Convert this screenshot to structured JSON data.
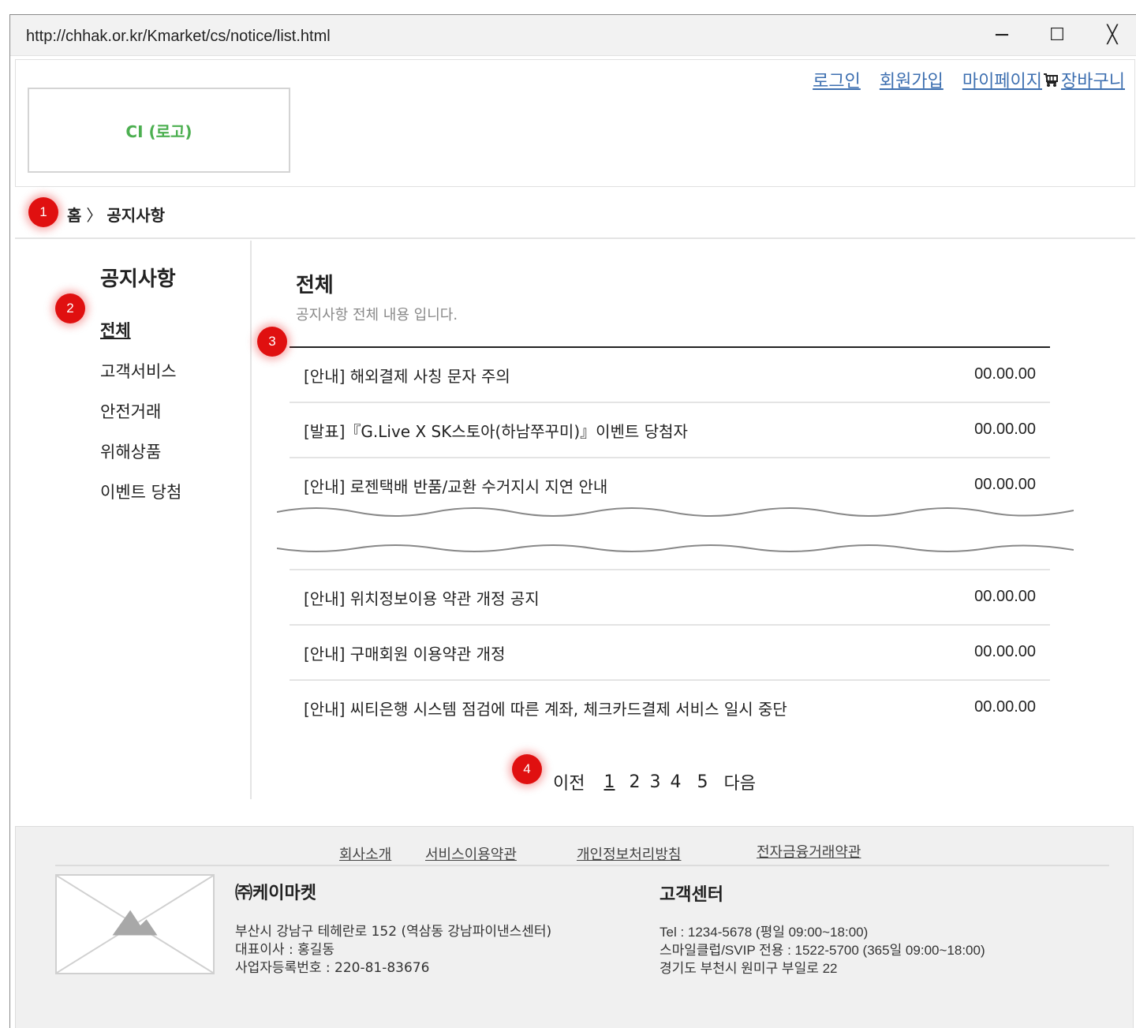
{
  "window": {
    "url": "http://chhak.or.kr/Kmarket/cs/notice/list.html",
    "minimize": "─",
    "maximize": "☐",
    "close": "╳"
  },
  "header": {
    "logo": "CI (로고)",
    "nav": {
      "login": "로그인",
      "signup": "회원가입",
      "mypage": "마이페이지",
      "cart": "장바구니"
    }
  },
  "breadcrumb": {
    "home": "홈",
    "separator": "〉",
    "current": "공지사항"
  },
  "annotations": [
    "1",
    "2",
    "3",
    "4"
  ],
  "sidebar": {
    "title": "공지사항",
    "items": [
      {
        "label": "전체"
      },
      {
        "label": "고객서비스"
      },
      {
        "label": "안전거래"
      },
      {
        "label": "위해상품"
      },
      {
        "label": "이벤트 당첨"
      }
    ]
  },
  "content": {
    "title": "전체",
    "description": "공지사항 전체 내용 입니다.",
    "rows_top": [
      {
        "title": "[안내] 해외결제 사칭 문자 주의",
        "date": "00.00.00"
      },
      {
        "title": "[발표]『G.Live X SK스토아(하남쭈꾸미)』이벤트 당첨자",
        "date": "00.00.00"
      },
      {
        "title": "[안내] 로젠택배 반품/교환 수거지시 지연 안내",
        "date": "00.00.00"
      }
    ],
    "rows_bottom": [
      {
        "title": "[안내] 위치정보이용 약관 개정 공지",
        "date": "00.00.00"
      },
      {
        "title": "[안내] 구매회원 이용약관 개정",
        "date": "00.00.00"
      },
      {
        "title": "[안내] 씨티은행 시스템 점검에 따른 계좌, 체크카드결제 서비스 일시 중단",
        "date": "00.00.00"
      }
    ]
  },
  "pagination": {
    "prev": "이전",
    "pages": [
      "1",
      "2",
      "3",
      "4",
      "5"
    ],
    "current": "1",
    "next": "다음"
  },
  "footer": {
    "links": [
      "회사소개",
      "서비스이용약관",
      "개인정보처리방침",
      "전자금융거래약관"
    ],
    "company": {
      "name": "㈜케이마켓",
      "address": "부산시 강남구 테헤란로 152 (역삼동 강남파이낸스센터)",
      "ceo": "대표이사 : 홍길동",
      "bizno": "사업자등록번호 : 220-81-83676"
    },
    "cs": {
      "title": "고객센터",
      "tel": "Tel : 1234-5678 (평일 09:00~18:00)",
      "vip": "스마일클럽/SVIP 전용 : 1522-5700 (365일 09:00~18:00)",
      "address": "경기도 부천시 원미구 부일로 22"
    }
  }
}
